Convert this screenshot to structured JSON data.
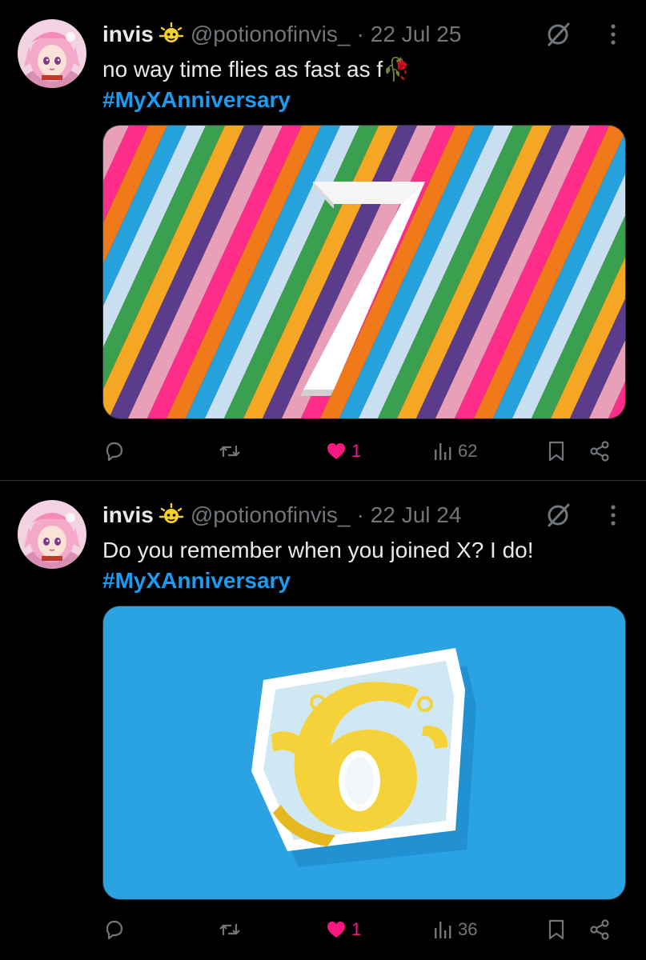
{
  "tweets": [
    {
      "author_name": "invis",
      "handle": "@potionofinvis_",
      "separator": "·",
      "date": "22 Jul 25",
      "text": "no way time flies as fast as f🥀",
      "hashtag": "#MyXAnniversary",
      "media_number": "7",
      "likes": "1",
      "views": "62",
      "replies": "",
      "reposts": ""
    },
    {
      "author_name": "invis",
      "handle": "@potionofinvis_",
      "separator": "·",
      "date": "22 Jul 24",
      "text": "Do you remember when you joined X? I do!",
      "hashtag": "#MyXAnniversary",
      "media_number": "6",
      "likes": "1",
      "views": "36",
      "replies": "",
      "reposts": ""
    }
  ],
  "icons": {
    "reply": "reply-icon",
    "repost": "repost-icon",
    "like": "heart-icon",
    "views": "views-icon",
    "bookmark": "bookmark-icon",
    "share": "share-icon",
    "grok": "grok-icon",
    "more": "more-icon"
  },
  "colors": {
    "background": "#000000",
    "text": "#e7e9ea",
    "secondary": "#71767b",
    "link": "#1d9bf0",
    "like": "#f91880",
    "divider": "#2f3336",
    "stripe_palette": [
      "#f5a623",
      "#5b3b8c",
      "#e8a0b8",
      "#ff2d8a",
      "#f07a1a",
      "#25a1dc",
      "#c8dff0",
      "#3a9f4e"
    ],
    "media_bg_6": "#2ba3e3",
    "badge_yellow": "#f7d02b",
    "number_yellow": "#f6d23a"
  }
}
